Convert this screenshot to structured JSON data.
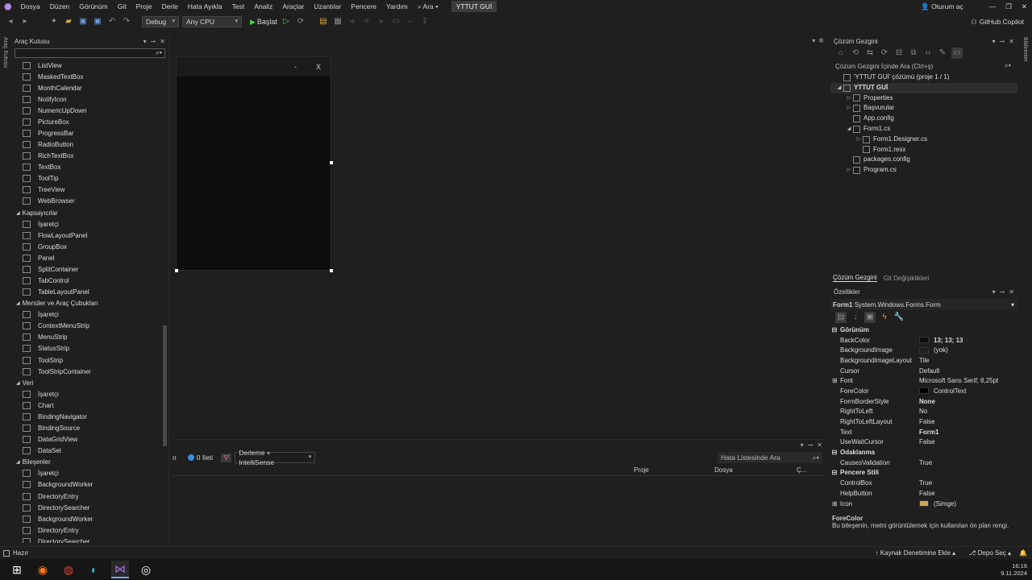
{
  "menu": {
    "items": [
      "Dosya",
      "Düzen",
      "Görünüm",
      "Git",
      "Proje",
      "Derle",
      "Hata Ayıkla",
      "Test",
      "Analiz",
      "Araçlar",
      "Uzantılar",
      "Pencere",
      "Yardım"
    ],
    "search_label": "Ara",
    "project_name": "YTTUT GUİ",
    "signin_label": "Oturum aç"
  },
  "toolbar": {
    "config": "Debug",
    "platform": "Any CPU",
    "start_label": "Başlat",
    "copilot_label": "GitHub Copilot"
  },
  "left_strip_label": "Araç Kutusu",
  "right_strip_label": "Bildirimler",
  "toolbox": {
    "title": "Araç Kutusu",
    "items": [
      {
        "kind": "item",
        "label": "ListView"
      },
      {
        "kind": "item",
        "label": "MaskedTextBox"
      },
      {
        "kind": "item",
        "label": "MonthCalendar"
      },
      {
        "kind": "item",
        "label": "NotifyIcon"
      },
      {
        "kind": "item",
        "label": "NumericUpDown"
      },
      {
        "kind": "item",
        "label": "PictureBox"
      },
      {
        "kind": "item",
        "label": "ProgressBar"
      },
      {
        "kind": "item",
        "label": "RadioButton"
      },
      {
        "kind": "item",
        "label": "RichTextBox"
      },
      {
        "kind": "item",
        "label": "TextBox"
      },
      {
        "kind": "item",
        "label": "ToolTip"
      },
      {
        "kind": "item",
        "label": "TreeView"
      },
      {
        "kind": "item",
        "label": "WebBrowser"
      },
      {
        "kind": "section",
        "label": "Kapsayıcılar"
      },
      {
        "kind": "item",
        "label": "İşaretçi"
      },
      {
        "kind": "item",
        "label": "FlowLayoutPanel"
      },
      {
        "kind": "item",
        "label": "GroupBox"
      },
      {
        "kind": "item",
        "label": "Panel"
      },
      {
        "kind": "item",
        "label": "SplitContainer"
      },
      {
        "kind": "item",
        "label": "TabControl"
      },
      {
        "kind": "item",
        "label": "TableLayoutPanel"
      },
      {
        "kind": "section",
        "label": "Menüler ve Araç Çubukları"
      },
      {
        "kind": "item",
        "label": "İşaretçi"
      },
      {
        "kind": "item",
        "label": "ContextMenuStrip"
      },
      {
        "kind": "item",
        "label": "MenuStrip"
      },
      {
        "kind": "item",
        "label": "StatusStrip"
      },
      {
        "kind": "item",
        "label": "ToolStrip"
      },
      {
        "kind": "item",
        "label": "ToolStripContainer"
      },
      {
        "kind": "section",
        "label": "Veri"
      },
      {
        "kind": "item",
        "label": "İşaretçi"
      },
      {
        "kind": "item",
        "label": "Chart"
      },
      {
        "kind": "item",
        "label": "BindingNavigator"
      },
      {
        "kind": "item",
        "label": "BindingSource"
      },
      {
        "kind": "item",
        "label": "DataGridView"
      },
      {
        "kind": "item",
        "label": "DataSet"
      },
      {
        "kind": "section",
        "label": "Bileşenler"
      },
      {
        "kind": "item",
        "label": "İşaretçi"
      },
      {
        "kind": "item",
        "label": "BackgroundWorker"
      },
      {
        "kind": "item",
        "label": "DirectoryEntry"
      },
      {
        "kind": "item",
        "label": "DirectorySearcher"
      },
      {
        "kind": "item",
        "label": "BackgroundWorker"
      },
      {
        "kind": "item",
        "label": "DirectoryEntry"
      },
      {
        "kind": "item",
        "label": "DirectorySearcher"
      }
    ]
  },
  "form_designer": {
    "minimize": "-",
    "close": "X"
  },
  "error_list": {
    "partial_label": "n",
    "messages": "0 İleti",
    "filter": "Derleme + IntelliSense",
    "search_placeholder": "Hata Listesinde Ara",
    "col_project": "Proje",
    "col_file": "Dosya",
    "col_line": "Ç..."
  },
  "solution_explorer": {
    "title": "Çözüm Gezgini",
    "search_placeholder": "Çözüm Gezgini İçinde Ara (Ctrl+ş)",
    "nodes": [
      {
        "label": "'YTTUT GUİ' çözümü (proje 1 / 1)",
        "depth": 0,
        "expander": ""
      },
      {
        "label": "YTTUT GUİ",
        "depth": 0,
        "expander": "◢",
        "selected": true
      },
      {
        "label": "Properties",
        "depth": 1,
        "expander": "▷"
      },
      {
        "label": "Başvurular",
        "depth": 1,
        "expander": "▷"
      },
      {
        "label": "App.config",
        "depth": 1,
        "expander": ""
      },
      {
        "label": "Form1.cs",
        "depth": 1,
        "expander": "◢"
      },
      {
        "label": "Form1.Designer.cs",
        "depth": 2,
        "expander": "▷"
      },
      {
        "label": "Form1.resx",
        "depth": 2,
        "expander": ""
      },
      {
        "label": "packages.config",
        "depth": 1,
        "expander": ""
      },
      {
        "label": "Program.cs",
        "depth": 1,
        "expander": "▷"
      }
    ],
    "tab_active": "Çözüm Gezgini",
    "tab_other": "Git Değişiklikleri"
  },
  "properties": {
    "title": "Özellikler",
    "object_name": "Form1",
    "object_type": "System.Windows.Forms.Form",
    "rows": [
      {
        "kind": "cat",
        "name": "Görünüm"
      },
      {
        "kind": "prop",
        "name": "BackColor",
        "value": "13; 13; 13",
        "swatch": "#0d0d0d",
        "bold": true
      },
      {
        "kind": "prop",
        "name": "BackgroundImage",
        "value": "(yok)",
        "swatch": "#1f1f1f"
      },
      {
        "kind": "prop",
        "name": "BackgroundImageLayout",
        "value": "Tile"
      },
      {
        "kind": "prop",
        "name": "Cursor",
        "value": "Default"
      },
      {
        "kind": "prop",
        "name": "Font",
        "value": "Microsoft Sans Serif; 8,25pt",
        "expand": true
      },
      {
        "kind": "prop",
        "name": "ForeColor",
        "value": "ControlText",
        "swatch": "#000000"
      },
      {
        "kind": "prop",
        "name": "FormBorderStyle",
        "value": "None",
        "bold": true
      },
      {
        "kind": "prop",
        "name": "RightToLeft",
        "value": "No"
      },
      {
        "kind": "prop",
        "name": "RightToLeftLayout",
        "value": "False"
      },
      {
        "kind": "prop",
        "name": "Text",
        "value": "Form1",
        "bold": true
      },
      {
        "kind": "prop",
        "name": "UseWaitCursor",
        "value": "False"
      },
      {
        "kind": "cat",
        "name": "Odaklanma"
      },
      {
        "kind": "prop",
        "name": "CausesValidation",
        "value": "True"
      },
      {
        "kind": "cat",
        "name": "Pencere Stili"
      },
      {
        "kind": "prop",
        "name": "ControlBox",
        "value": "True"
      },
      {
        "kind": "prop",
        "name": "HelpButton",
        "value": "False"
      },
      {
        "kind": "prop",
        "name": "Icon",
        "value": "(Simge)",
        "swatch": "#c9a84a",
        "expand": true
      }
    ],
    "desc_title": "ForeColor",
    "desc_text": "Bu bileşenin, metni görüntülemek için kullanılan ön plan rengi."
  },
  "status": {
    "left": "Hazır",
    "source_control": "Kaynak Denetimine Ekle",
    "repo": "Depo Seç"
  },
  "taskbar": {
    "time": "16:16",
    "date": "9.11.2024"
  }
}
